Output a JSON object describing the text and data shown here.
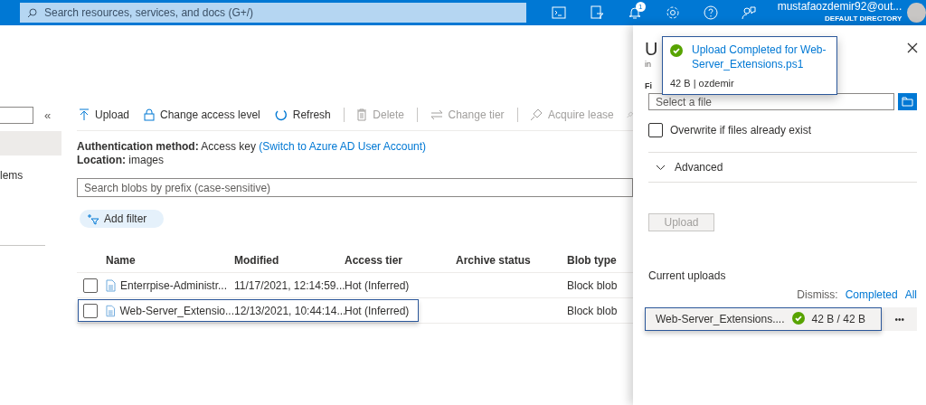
{
  "top_bar": {
    "search": {
      "placeholder": "Search resources, services, and docs (G+/)"
    },
    "notification_count": "1",
    "user": {
      "name": "mustafaozdemir92@out...",
      "directory": "DEFAULT DIRECTORY"
    }
  },
  "sidebar": {
    "collapse": "«",
    "items": [
      {
        "selected": true
      },
      {
        "label": "lems",
        "selected": false
      }
    ]
  },
  "toolbar": [
    {
      "kind": "upload",
      "label": "Upload",
      "disabled": false,
      "separator_before": false
    },
    {
      "kind": "lock",
      "label": "Change access level",
      "disabled": false,
      "separator_before": false
    },
    {
      "kind": "refresh",
      "label": "Refresh",
      "disabled": false,
      "separator_before": false
    },
    {
      "kind": "delete",
      "label": "Delete",
      "disabled": true,
      "separator_before": true
    },
    {
      "kind": "swap",
      "label": "Change tier",
      "disabled": true,
      "separator_before": true
    },
    {
      "kind": "lease",
      "label": "Acquire lease",
      "disabled": true,
      "separator_before": true
    }
  ],
  "info": {
    "auth_label": "Authentication method:",
    "auth_value": "Access key",
    "auth_link": "(Switch to Azure AD User Account)",
    "location_label": "Location:",
    "location_value": "images"
  },
  "blob_search": {
    "placeholder": "Search blobs by prefix (case-sensitive)"
  },
  "add_filter": "Add filter",
  "table": {
    "columns": [
      "Name",
      "Modified",
      "Access tier",
      "Archive status",
      "Blob type"
    ],
    "rows": [
      {
        "name": "Enterrpise-Administr...",
        "modified": "11/17/2021, 12:14:59...",
        "tier": "Hot (Inferred)",
        "type": "Block blob",
        "checked": false,
        "selected": false
      },
      {
        "name": "Web-Server_Extensio...",
        "modified": "12/13/2021, 10:44:14...",
        "tier": "Hot (Inferred)",
        "type": "Block blob",
        "checked": false,
        "selected": true
      }
    ]
  },
  "upload_panel": {
    "title": "U",
    "subtitle": "in",
    "field_label": "Fi",
    "file_field": {
      "placeholder": "Select a file"
    },
    "overwrite": {
      "label": "Overwrite if files already exist",
      "checked": false
    },
    "advanced": {
      "label": "Advanced",
      "expanded": false
    },
    "upload_button": {
      "label": "Upload",
      "disabled": true
    },
    "current_uploads": "Current uploads",
    "dismiss_label": "Dismiss:",
    "dismiss_links": [
      "Completed",
      "All"
    ],
    "uploads": [
      {
        "name": "Web-Server_Extensions....",
        "progress": "42 B / 42 B",
        "done": true,
        "selected": true,
        "more": "•••"
      }
    ]
  },
  "toast": {
    "title": "Upload Completed for Web-Server_Extensions.ps1",
    "detail": "42 B | ozdemir"
  }
}
